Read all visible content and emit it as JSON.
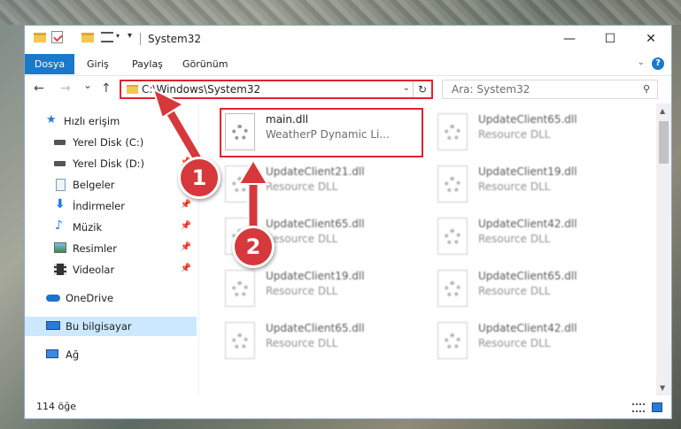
{
  "window": {
    "title": "System32",
    "minimize": "—",
    "maximize": "☐",
    "close": "✕"
  },
  "ribbon": {
    "tabs": [
      "Dosya",
      "Giriş",
      "Paylaş",
      "Görünüm"
    ],
    "help": "?"
  },
  "nav": {
    "back": "←",
    "forward": "→",
    "recent": "⌄",
    "up": "↑",
    "address": "C:\\Windows\\System32",
    "search_placeholder": "Ara: System32"
  },
  "sidebar": {
    "items": [
      {
        "label": "Hızlı erişim",
        "icon": "star-icon",
        "pinned": false
      },
      {
        "label": "Yerel Disk (C:)",
        "icon": "drive-icon",
        "pinned": true
      },
      {
        "label": "Yerel Disk (D:)",
        "icon": "drive-icon",
        "pinned": true
      },
      {
        "label": "Belgeler",
        "icon": "documents-icon",
        "pinned": true
      },
      {
        "label": "İndirmeler",
        "icon": "download-icon",
        "pinned": true
      },
      {
        "label": "Müzik",
        "icon": "music-icon",
        "pinned": true
      },
      {
        "label": "Resimler",
        "icon": "pictures-icon",
        "pinned": true
      },
      {
        "label": "Videolar",
        "icon": "videos-icon",
        "pinned": true
      },
      {
        "label": "OneDrive",
        "icon": "cloud-icon",
        "pinned": false
      },
      {
        "label": "Bu bilgisayar",
        "icon": "computer-icon",
        "pinned": false,
        "selected": true
      },
      {
        "label": "Ağ",
        "icon": "network-icon",
        "pinned": false
      }
    ]
  },
  "files": [
    {
      "name": "main.dll",
      "desc": "WeatherP Dynamic Li...",
      "highlighted": true
    },
    {
      "name": "UpdateClient65.dll",
      "desc": "Resource DLL"
    },
    {
      "name": "UpdateClient21.dll",
      "desc": "Resource DLL"
    },
    {
      "name": "UpdateClient19.dll",
      "desc": "Resource DLL"
    },
    {
      "name": "UpdateClient65.dll",
      "desc": "Resource DLL"
    },
    {
      "name": "UpdateClient42.dll",
      "desc": "Resource DLL"
    },
    {
      "name": "UpdateClient19.dll",
      "desc": "Resource DLL"
    },
    {
      "name": "UpdateClient65.dll",
      "desc": "Resource DLL"
    },
    {
      "name": "UpdateClient65.dll",
      "desc": "Resource DLL"
    },
    {
      "name": "UpdateClient42.dll",
      "desc": "Resource DLL"
    }
  ],
  "status": {
    "count": "114 öğe"
  },
  "callouts": [
    "1",
    "2"
  ],
  "colors": {
    "accent": "#1979ca",
    "highlight_border": "#e0242a",
    "callout": "#d6393b",
    "selection": "#cce8ff"
  }
}
